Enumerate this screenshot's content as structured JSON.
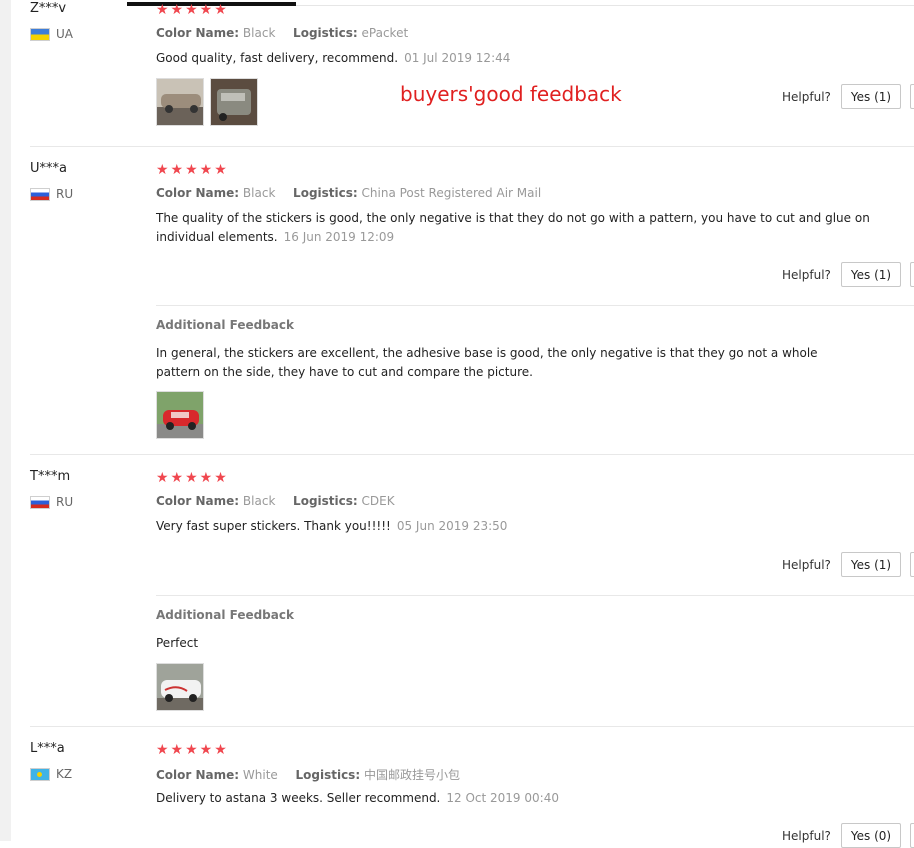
{
  "annotation": "buyers'good feedback",
  "helpful_label": "Helpful?",
  "additional_label": "Additional Feedback",
  "reviews": [
    {
      "user": "Z***v",
      "country": "UA",
      "stars": "★★★★★",
      "color_label": "Color Name:",
      "color": "Black",
      "logistics_label": "Logistics:",
      "logistics": "ePacket",
      "text": "Good quality, fast delivery, recommend.",
      "date": "01 Jul 2019 12:44",
      "yes": "Yes (1)"
    },
    {
      "user": "U***a",
      "country": "RU",
      "stars": "★★★★★",
      "color_label": "Color Name:",
      "color": "Black",
      "logistics_label": "Logistics:",
      "logistics": "China Post Registered Air Mail",
      "text_line1": "The quality of the stickers is good, the only negative is that they do not go with a pattern, you have to cut and glue on",
      "text_line2": "individual elements.",
      "date": "16 Jun 2019 12:09",
      "yes": "Yes (1)",
      "additional_line1": "In general, the stickers are excellent, the adhesive base is good, the only negative is that they go not a whole",
      "additional_line2": "pattern on the side, they have to cut and compare the picture."
    },
    {
      "user": "T***m",
      "country": "RU",
      "stars": "★★★★★",
      "color_label": "Color Name:",
      "color": "Black",
      "logistics_label": "Logistics:",
      "logistics": "CDEK",
      "text": "Very fast super stickers. Thank you!!!!!",
      "date": "05 Jun 2019 23:50",
      "yes": "Yes (1)",
      "additional": "Perfect"
    },
    {
      "user": "L***a",
      "country": "KZ",
      "stars": "★★★★★",
      "color_label": "Color Name:",
      "color": "White",
      "logistics_label": "Logistics:",
      "logistics": "中国邮政挂号小包",
      "text": "Delivery to astana 3 weeks. Seller recommend.",
      "date": "12 Oct 2019 00:40",
      "yes": "Yes (0)"
    }
  ]
}
